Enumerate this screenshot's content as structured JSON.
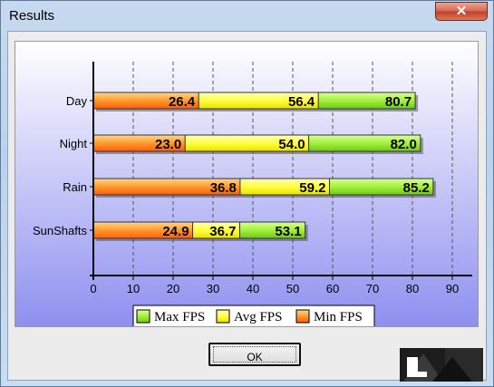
{
  "window": {
    "title": "Results",
    "close_glyph": "✕"
  },
  "ok_button": {
    "label": "OK"
  },
  "colors": {
    "plot_bg_top": "#ffffff",
    "plot_bg_bottom": "#8f8ff0",
    "max_fps": "#a4f03a",
    "avg_fps": "#ffff40",
    "min_fps": "#ff9a2a"
  },
  "chart_data": {
    "type": "bar",
    "orientation": "horizontal",
    "stacked": "overlaid",
    "categories": [
      "Day",
      "Night",
      "Rain",
      "SunShafts"
    ],
    "series": [
      {
        "name": "Max FPS",
        "color": "#a4f03a",
        "values": [
          80.7,
          82.0,
          85.2,
          53.1
        ],
        "labels": [
          "80.7",
          "82.0",
          "85.2",
          "53.1"
        ]
      },
      {
        "name": "Avg FPS",
        "color": "#ffff40",
        "values": [
          56.4,
          54.0,
          59.2,
          36.7
        ],
        "labels": [
          "56.4",
          "54.0",
          "59.2",
          "36.7"
        ]
      },
      {
        "name": "Min FPS",
        "color": "#ff9a2a",
        "values": [
          26.4,
          23.0,
          36.8,
          24.9
        ],
        "labels": [
          "26.4",
          "23.0",
          "36.8",
          "24.9"
        ]
      }
    ],
    "xlim": [
      0,
      95
    ],
    "xticks": [
      "0",
      "10",
      "20",
      "30",
      "40",
      "50",
      "60",
      "70",
      "80",
      "90"
    ],
    "xtick_values": [
      0,
      10,
      20,
      30,
      40,
      50,
      60,
      70,
      80,
      90
    ],
    "grid": "vertical dashed",
    "legend_position": "bottom-center"
  }
}
